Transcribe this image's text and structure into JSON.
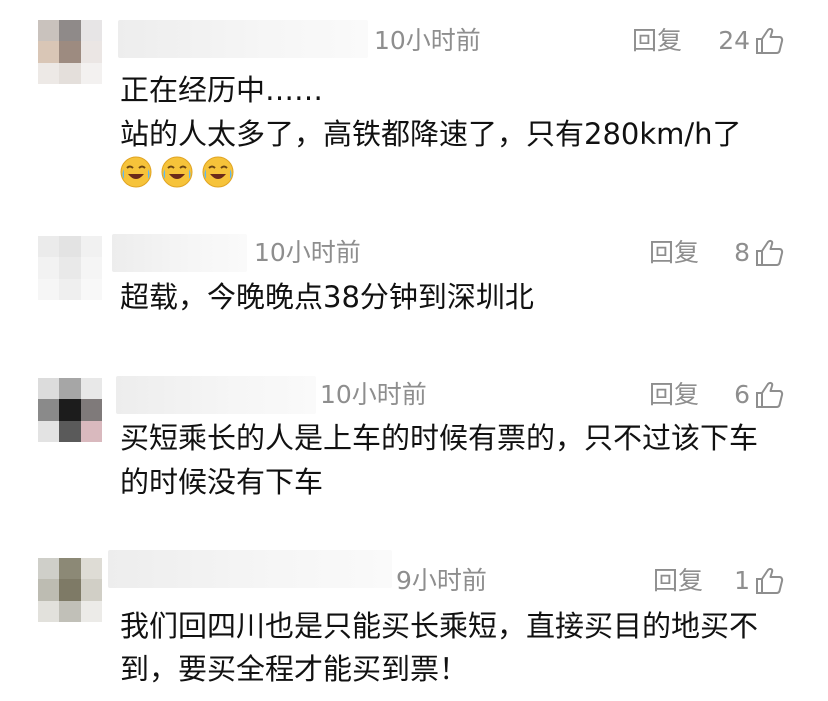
{
  "comments": [
    {
      "time": "10小时前",
      "reply_label": "回复",
      "likes": "24",
      "lines": [
        "正在经历中……",
        "站的人太多了，高铁都降速了，只有280km/h了"
      ],
      "emojis": [
        "crying-laughing-emoji",
        "crying-laughing-emoji",
        "crying-laughing-emoji"
      ]
    },
    {
      "time": "10小时前",
      "reply_label": "回复",
      "likes": "8",
      "lines": [
        "超载，今晚晚点38分钟到深圳北"
      ]
    },
    {
      "time": "10小时前",
      "reply_label": "回复",
      "likes": "6",
      "lines": [
        "买短乘长的人是上车的时候有票的，只不过该下车",
        "的时候没有下车"
      ]
    },
    {
      "time": "9小时前",
      "reply_label": "回复",
      "likes": "1",
      "lines": [
        "我们回四川也是只能买长乘短，直接买目的地买不",
        "到，要买全程才能买到票！"
      ]
    }
  ],
  "icons": {
    "like": "thumbs-up-icon",
    "avatar": "blurred-avatar"
  },
  "colors": {
    "meta_text": "#8e8e8e",
    "body_text": "#111111",
    "background": "#ffffff"
  }
}
